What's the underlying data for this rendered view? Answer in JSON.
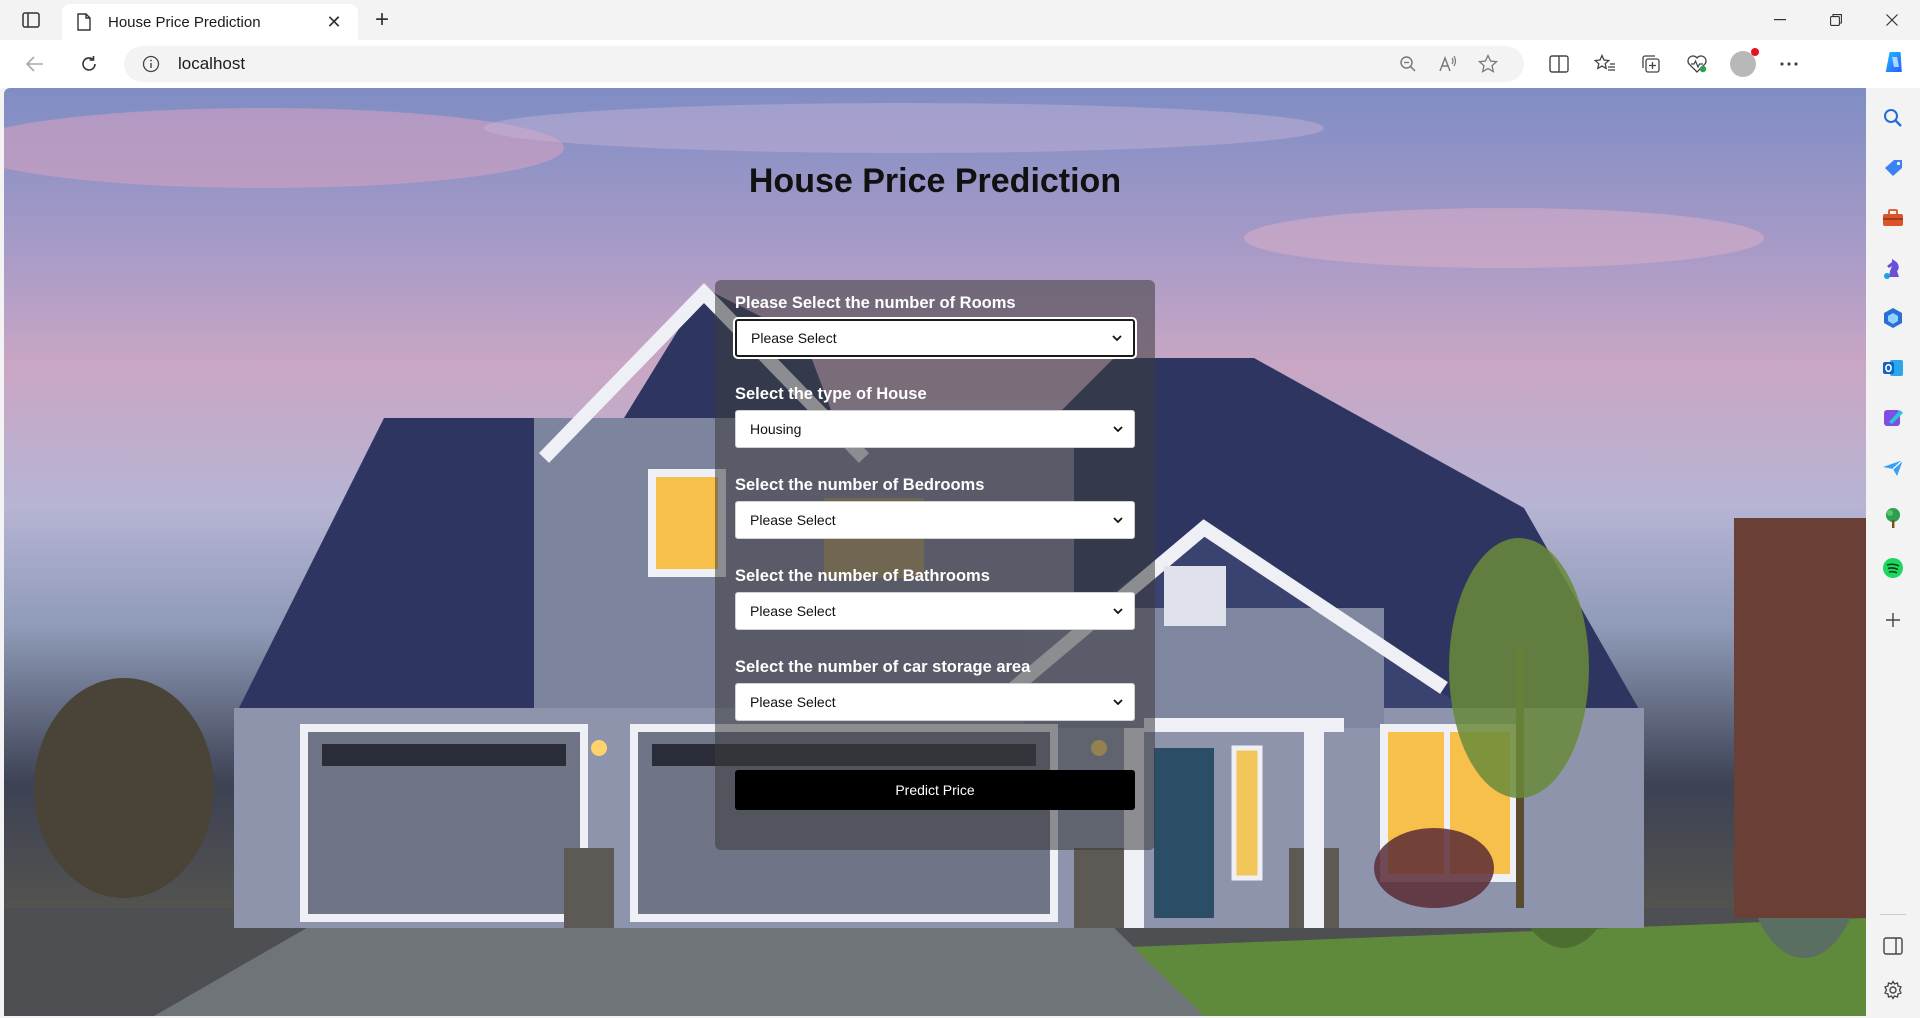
{
  "browser": {
    "tab_title": "House Price Prediction",
    "url": "localhost"
  },
  "page": {
    "title": "House Price Prediction",
    "fields": [
      {
        "label": "Please Select the number of Rooms",
        "value": "Please Select"
      },
      {
        "label": "Select the type of House",
        "value": "Housing"
      },
      {
        "label": "Select the number of Bedrooms",
        "value": "Please Select"
      },
      {
        "label": "Select the number of Bathrooms",
        "value": "Please Select"
      },
      {
        "label": "Select the number of car storage area",
        "value": "Please Select"
      }
    ],
    "submit_label": "Predict Price"
  },
  "colors": {
    "panel_overlay": "rgba(60,60,60,0.55)",
    "button_bg": "#000000",
    "button_text": "#ffffff",
    "label_text": "#ffffff"
  }
}
